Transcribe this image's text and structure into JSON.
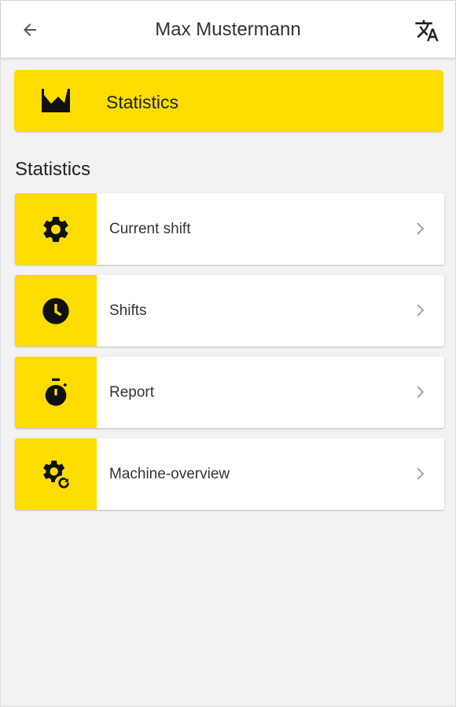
{
  "header": {
    "title": "Max Mustermann",
    "back_icon": "arrow-back-icon",
    "translate_icon": "translate-icon"
  },
  "hero": {
    "label": "Statistics",
    "icon": "area-chart-icon"
  },
  "section": {
    "title": "Statistics"
  },
  "items": [
    {
      "label": "Current shift",
      "icon": "gear-icon"
    },
    {
      "label": "Shifts",
      "icon": "clock-icon"
    },
    {
      "label": "Report",
      "icon": "stopwatch-icon"
    },
    {
      "label": "Machine-overview",
      "icon": "gear-sync-icon"
    }
  ],
  "colors": {
    "accent": "#fddd00",
    "background": "#f2f2f2",
    "card": "#ffffff",
    "text": "#333333"
  }
}
